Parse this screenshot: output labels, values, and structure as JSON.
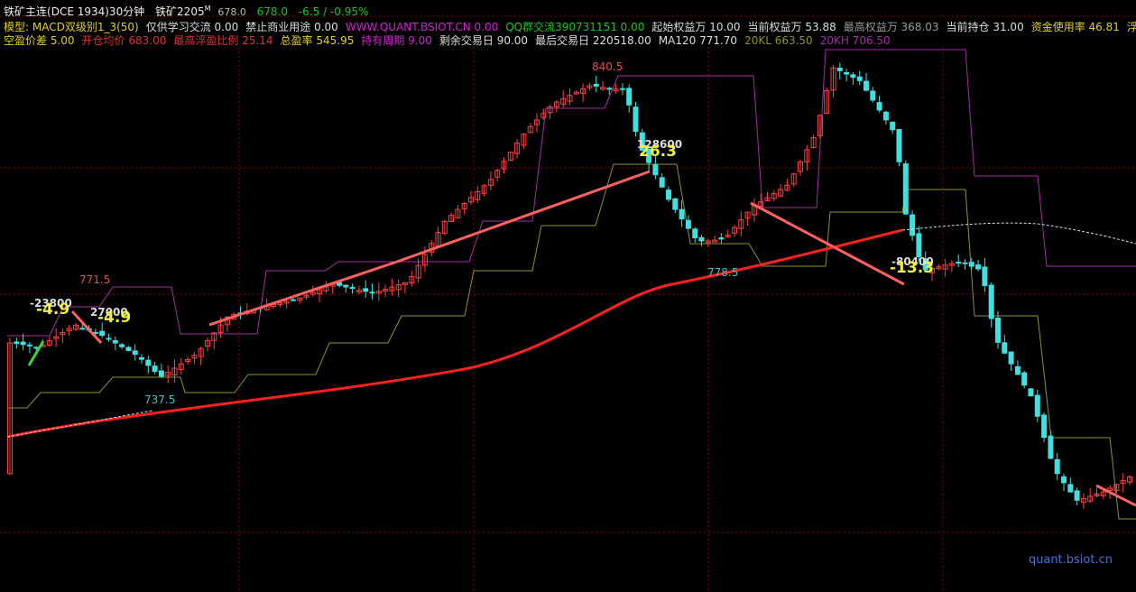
{
  "header": {
    "symbol": "铁矿主连",
    "exchange_period": "(DCE 1934)30分钟",
    "contract": "铁矿2205",
    "contract_sup": "M",
    "last_small": "678.0",
    "last": "678.0",
    "change": "-6.5 / -0.95%"
  },
  "stats_row1": [
    {
      "text": "模型: MACD双级别1_3(50)",
      "color": "#e0d020"
    },
    {
      "text": "仅供学习交流 0.00",
      "color": "#dddddd"
    },
    {
      "text": "禁止商业用途 0.00",
      "color": "#dddddd"
    },
    {
      "text": "WWW.QUANT.BSIOT.CN 0.00",
      "color": "#d020d0"
    },
    {
      "text": "QQ群交流390731151 0.00",
      "color": "#20c020"
    },
    {
      "text": "起始权益万 10.00",
      "color": "#dddddd"
    },
    {
      "text": "当前权益万 53.88",
      "color": "#dddddd"
    },
    {
      "text": "最高权益万 368.03",
      "color": "#999999"
    },
    {
      "text": "当前持仓 31.00",
      "color": "#dddddd"
    },
    {
      "text": "资金使用率 46.81",
      "color": "#e0d020"
    },
    {
      "text": "浮盈",
      "color": "#e0d020"
    }
  ],
  "stats_row2": [
    {
      "text": "空盈价差 5.00",
      "color": "#e0d020"
    },
    {
      "text": "开仓均价 683.00",
      "color": "#e03030"
    },
    {
      "text": "最高浮盈比例 25.14",
      "color": "#e03030"
    },
    {
      "text": "总盈率 545.95",
      "color": "#e0d020"
    },
    {
      "text": "持有周期 9.00",
      "color": "#d020d0"
    },
    {
      "text": "剩余交易日 90.00",
      "color": "#dddddd"
    },
    {
      "text": "最后交易日 220518.00",
      "color": "#dddddd"
    },
    {
      "text": "MA120 771.70",
      "color": "#dddddd"
    },
    {
      "text": "20KL 663.50",
      "color": "#909030"
    },
    {
      "text": "20KH 706.50",
      "color": "#a030a0"
    }
  ],
  "annotations": {
    "high_1": "771.5",
    "high_2": "840.5",
    "low_1": "737.5",
    "low_2": "778.5",
    "trade_1": "-4.9",
    "trade_2": "-4.9",
    "trade_3": "26.3",
    "trade_4": "-13.3",
    "pos_1": "-23800",
    "pos_2": "27000",
    "pos_3": "128600",
    "pos_4": "-80400"
  },
  "watermark": "quant.bsiot.cn",
  "colors": {
    "up": "#ff4040",
    "down": "#40e0e0",
    "ma": "#ff2020",
    "channel_low": "#909030",
    "channel_high": "#a030a0",
    "trade_line": "#ff6060",
    "grid": "#8b0000"
  }
}
